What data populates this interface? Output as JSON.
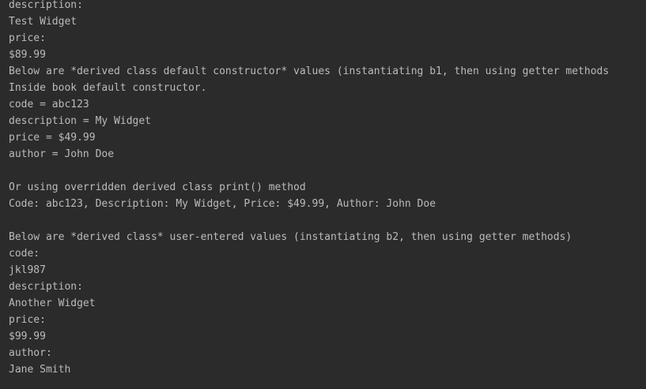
{
  "console": {
    "lines": [
      "description:",
      "Test Widget",
      "price:",
      "$89.99",
      "Below are *derived class default constructor* values (instantiating b1, then using getter methods",
      "Inside book default constructor.",
      "code = abc123",
      "description = My Widget",
      "price = $49.99",
      "author = John Doe",
      "",
      "Or using overridden derived class print() method",
      "Code: abc123, Description: My Widget, Price: $49.99, Author: John Doe",
      "",
      "Below are *derived class* user-entered values (instantiating b2, then using getter methods)",
      "code:",
      "jkl987",
      "description:",
      "Another Widget",
      "price:",
      "$99.99",
      "author:",
      "Jane Smith"
    ]
  },
  "colors": {
    "background": "#2b2b2b",
    "text": "#bbbbbb"
  }
}
